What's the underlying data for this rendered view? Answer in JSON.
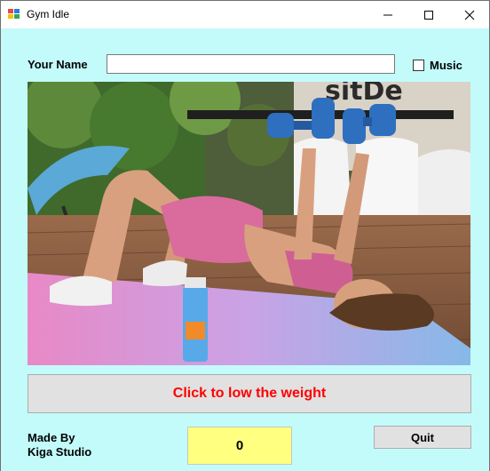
{
  "window": {
    "title": "Gym Idle"
  },
  "form": {
    "name_label": "Your Name",
    "name_value": "",
    "music_label": "Music",
    "music_checked": false
  },
  "photo": {
    "sign_text": "sitDe"
  },
  "actions": {
    "lift_label": "Click to low the weight",
    "quit_label": "Quit"
  },
  "footer": {
    "made_by_line1": "Made By",
    "made_by_line2": "Kiga Studio"
  },
  "counter": {
    "value": "0"
  },
  "colors": {
    "background": "#c3fbfb",
    "lift_text": "#ff0000",
    "counter_bg": "#ffff80",
    "button_bg": "#e1e1e1"
  }
}
